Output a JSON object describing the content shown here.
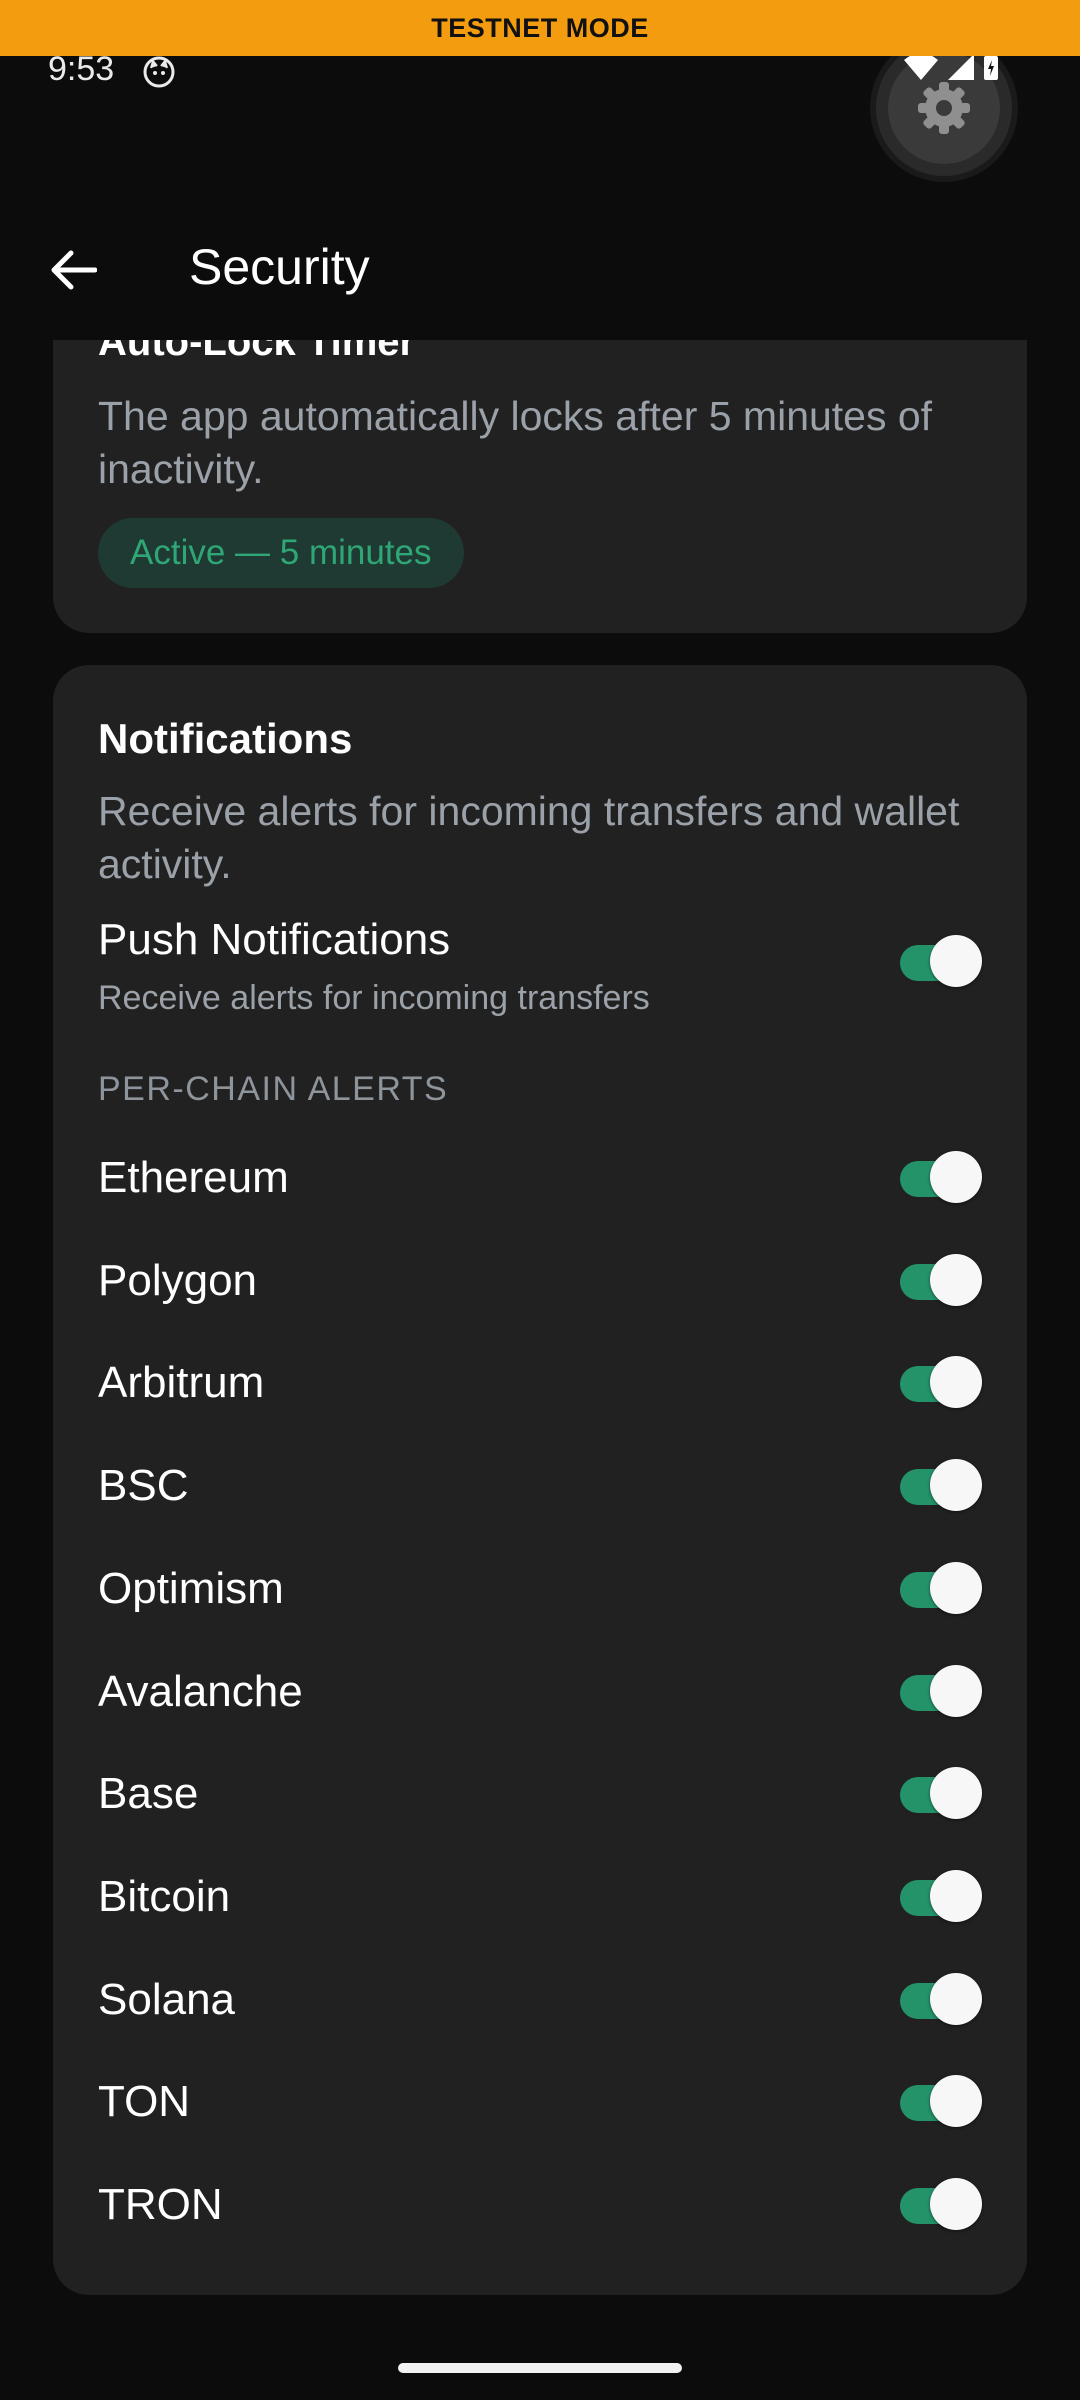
{
  "banner": {
    "text": "TESTNET MODE"
  },
  "status_bar": {
    "time": "9:53",
    "icons": [
      "cat-icon",
      "wifi-icon",
      "signal-icon",
      "battery-icon"
    ]
  },
  "fab": {
    "icon": "gear-icon"
  },
  "app_bar": {
    "title": "Security",
    "back_icon": "arrow-left-icon"
  },
  "auto_lock": {
    "title": "Auto-Lock Timer",
    "description": "The app automatically locks after 5 minutes of inactivity.",
    "status_pill": "Active — 5 minutes"
  },
  "notifications": {
    "title": "Notifications",
    "description": "Receive alerts for incoming transfers and wallet activity.",
    "push": {
      "title": "Push Notifications",
      "subtitle": "Receive alerts for incoming transfers",
      "enabled": true
    },
    "per_chain_label": "PER-CHAIN ALERTS",
    "chains": [
      {
        "name": "Ethereum",
        "enabled": true
      },
      {
        "name": "Polygon",
        "enabled": true
      },
      {
        "name": "Arbitrum",
        "enabled": true
      },
      {
        "name": "BSC",
        "enabled": true
      },
      {
        "name": "Optimism",
        "enabled": true
      },
      {
        "name": "Avalanche",
        "enabled": true
      },
      {
        "name": "Base",
        "enabled": true
      },
      {
        "name": "Bitcoin",
        "enabled": true
      },
      {
        "name": "Solana",
        "enabled": true
      },
      {
        "name": "TON",
        "enabled": true
      },
      {
        "name": "TRON",
        "enabled": true
      }
    ]
  },
  "colors": {
    "accent": "#24936a",
    "banner": "#f39c0f",
    "card": "#212121",
    "background": "#0c0c0c"
  }
}
